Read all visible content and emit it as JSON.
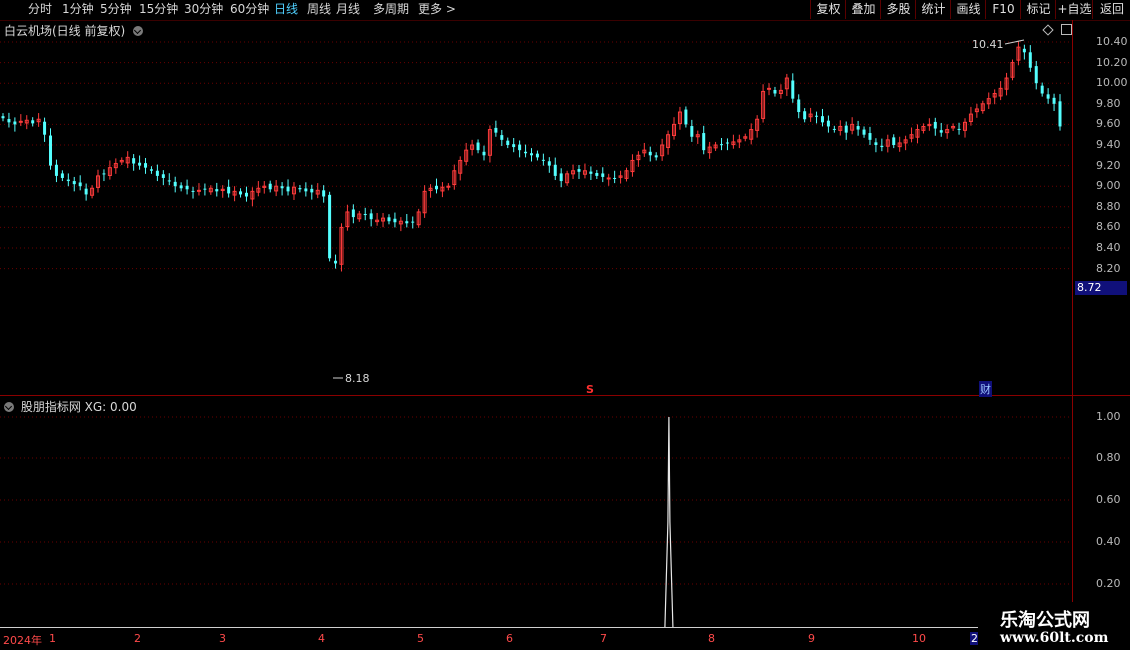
{
  "toolbar": {
    "periods": [
      "分时",
      "1分钟",
      "5分钟",
      "15分钟",
      "30分钟",
      "60分钟",
      "日线",
      "周线",
      "月线",
      "多周期",
      "更多 >"
    ],
    "active_period": "日线",
    "right_tabs": [
      "复权",
      "叠加",
      "多股",
      "统计",
      "画线",
      "F10",
      "标记",
      "+自选",
      "返回"
    ]
  },
  "main_chart": {
    "title": "白云机场(日线 前复权)",
    "y_ticks": [
      "10.40",
      "10.20",
      "10.00",
      "9.80",
      "9.60",
      "9.40",
      "9.20",
      "9.00",
      "8.80",
      "8.60",
      "8.40",
      "8.20"
    ],
    "current_price": "8.72",
    "high_label": "10.41",
    "low_label": "8.18",
    "marker_s": "S",
    "marker_cai": "财"
  },
  "indicator": {
    "title": "股朋指标网 XG: 0.00",
    "y_ticks": [
      "1.00",
      "0.80",
      "0.60",
      "0.40",
      "0.20"
    ]
  },
  "timeline": {
    "year_label": "2024年",
    "months": [
      "1",
      "2",
      "3",
      "4",
      "5",
      "6",
      "7",
      "8",
      "9",
      "10",
      "2"
    ]
  },
  "watermark": {
    "line1": "乐淘公式网",
    "line2": "www.60lt.com"
  },
  "colors": {
    "up": "#ff3b3b",
    "down": "#54ffff",
    "grid": "#8a0000",
    "active": "#4fd0ff"
  },
  "chart_data": [
    {
      "type": "candlestick",
      "title": "白云机场(日线 前复权)",
      "ylim": [
        8.1,
        10.5
      ],
      "closes": [
        9.66,
        9.62,
        9.6,
        9.63,
        9.64,
        9.61,
        9.65,
        9.5,
        9.2,
        9.1,
        9.08,
        9.05,
        9.02,
        9.0,
        8.92,
        8.98,
        9.1,
        9.12,
        9.18,
        9.22,
        9.25,
        9.28,
        9.22,
        9.2,
        9.18,
        9.15,
        9.1,
        9.08,
        9.05,
        9.0,
        8.98,
        8.97,
        8.95,
        8.96,
        8.97,
        8.98,
        8.95,
        8.97,
        8.93,
        8.95,
        8.92,
        8.9,
        8.95,
        8.98,
        9.0,
        8.97,
        9.0,
        8.98,
        8.95,
        8.99,
        8.97,
        8.95,
        8.94,
        8.96,
        8.9,
        8.3,
        8.25,
        8.6,
        8.75,
        8.7,
        8.73,
        8.72,
        8.68,
        8.67,
        8.69,
        8.66,
        8.65,
        8.66,
        8.64,
        8.65,
        8.75,
        8.95,
        8.98,
        8.97,
        8.99,
        9.0,
        9.15,
        9.25,
        9.35,
        9.4,
        9.35,
        9.3,
        9.55,
        9.52,
        9.45,
        9.4,
        9.38,
        9.35,
        9.32,
        9.3,
        9.28,
        9.25,
        9.2,
        9.1,
        9.05,
        9.12,
        9.15,
        9.14,
        9.15,
        9.12,
        9.1,
        9.09,
        9.08,
        9.07,
        9.1,
        9.15,
        9.25,
        9.3,
        9.35,
        9.3,
        9.28,
        9.4,
        9.5,
        9.6,
        9.72,
        9.6,
        9.48,
        9.5,
        9.35,
        9.38,
        9.4,
        9.4,
        9.42,
        9.43,
        9.45,
        9.48,
        9.55,
        9.65,
        9.92,
        9.95,
        9.9,
        9.93,
        10.05,
        9.85,
        9.72,
        9.65,
        9.7,
        9.68,
        9.62,
        9.58,
        9.55,
        9.58,
        9.52,
        9.6,
        9.55,
        9.5,
        9.45,
        9.4,
        9.38,
        9.45,
        9.4,
        9.42,
        9.45,
        9.5,
        9.55,
        9.58,
        9.6,
        9.56,
        9.52,
        9.55,
        9.58,
        9.55,
        9.62,
        9.7,
        9.75,
        9.8,
        9.85,
        9.9,
        9.95,
        10.05,
        10.2,
        10.35,
        10.3,
        10.15,
        10.0,
        9.9,
        9.85,
        9.8,
        9.58
      ]
    },
    {
      "type": "line",
      "title": "股朋指标网 XG: 0.00",
      "ylim": [
        0,
        1.05
      ],
      "spike_at_fraction": 0.63,
      "spike_value": 1.0,
      "baseline": 0.0
    }
  ]
}
